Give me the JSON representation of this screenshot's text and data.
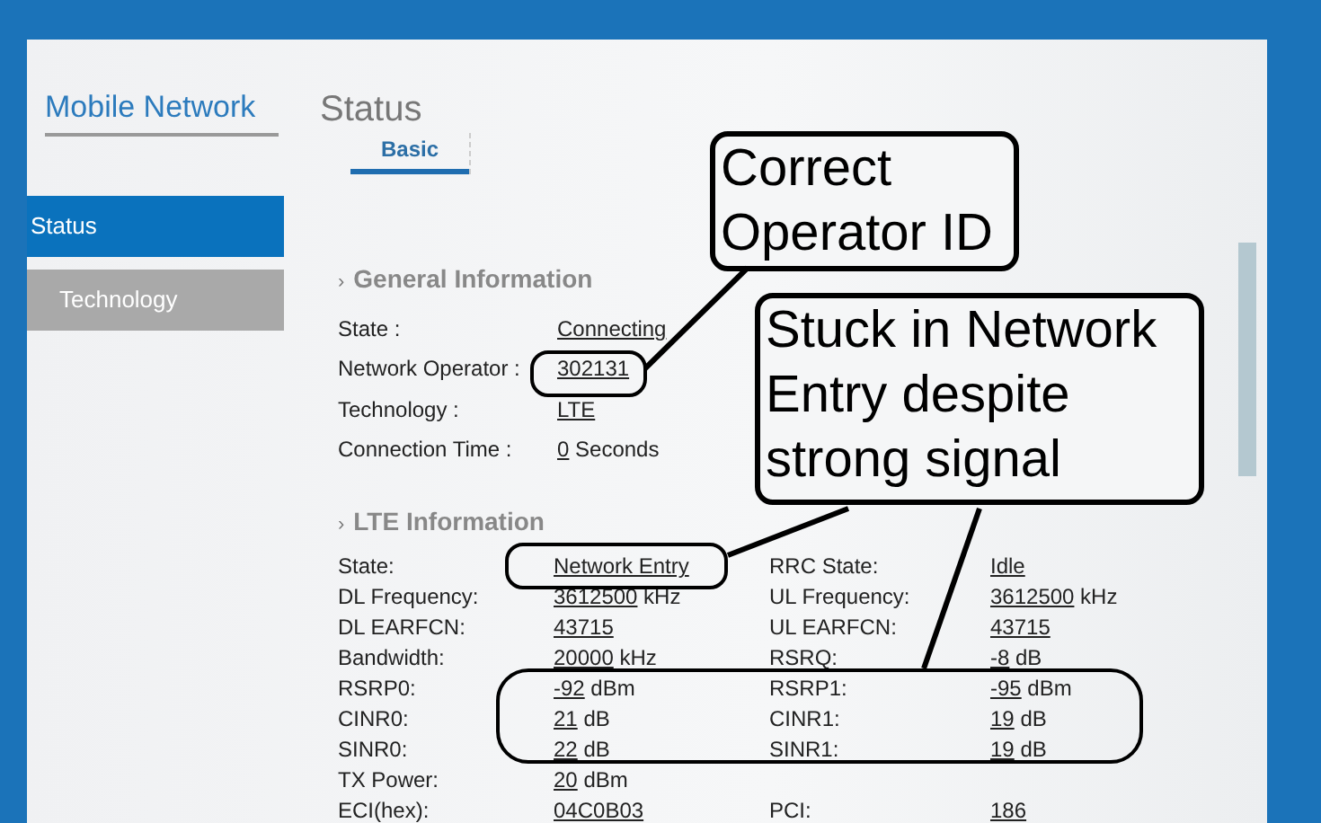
{
  "sidebar": {
    "title": "Mobile Network",
    "items": [
      {
        "label": "Status",
        "selected": true
      },
      {
        "label": "Technology",
        "selected": false
      }
    ]
  },
  "page_title": "Status",
  "tabs": [
    {
      "label": "Basic",
      "selected": true
    }
  ],
  "sections": [
    {
      "title": "General Information",
      "marker": "›",
      "kind": "single",
      "rows": [
        [
          {
            "label": "State :",
            "value": "Connecting"
          }
        ],
        [
          {
            "label": "Network Operator :",
            "value": "302131"
          }
        ],
        [
          {
            "label": "Technology :",
            "value": "LTE"
          }
        ],
        [
          {
            "label": "Connection Time :",
            "value": "0",
            "unit": "Seconds"
          }
        ]
      ]
    },
    {
      "title": "LTE Information",
      "marker": "›",
      "kind": "pairs",
      "rows": [
        [
          {
            "label": "State:",
            "value": "Network Entry"
          },
          {
            "label": "RRC State:",
            "value": "Idle"
          }
        ],
        [
          {
            "label": "DL Frequency:",
            "value": "3612500",
            "unit": "kHz"
          },
          {
            "label": "UL Frequency:",
            "value": "3612500",
            "unit": "kHz"
          }
        ],
        [
          {
            "label": "DL EARFCN:",
            "value": "43715"
          },
          {
            "label": "UL EARFCN:",
            "value": "43715"
          }
        ],
        [
          {
            "label": "Bandwidth:",
            "value": "20000",
            "unit": "kHz"
          },
          {
            "label": "RSRQ:",
            "value": "-8",
            "unit": "dB"
          }
        ],
        [
          {
            "label": "RSRP0:",
            "value": "-92",
            "unit": "dBm"
          },
          {
            "label": "RSRP1:",
            "value": "-95",
            "unit": "dBm"
          }
        ],
        [
          {
            "label": "CINR0:",
            "value": "21",
            "unit": "dB"
          },
          {
            "label": "CINR1:",
            "value": "19",
            "unit": "dB"
          }
        ],
        [
          {
            "label": "SINR0:",
            "value": "22",
            "unit": "dB"
          },
          {
            "label": "SINR1:",
            "value": "19",
            "unit": "dB"
          }
        ],
        [
          {
            "label": "TX Power:",
            "value": "20",
            "unit": "dBm"
          }
        ],
        [
          {
            "label": "ECI(hex):",
            "value": "04C0B03"
          },
          {
            "label": "PCI:",
            "value": "186"
          }
        ]
      ]
    }
  ],
  "annotations": [
    {
      "text": "Correct Operator ID"
    },
    {
      "text": "Stuck in Network Entry despite strong signal"
    }
  ]
}
